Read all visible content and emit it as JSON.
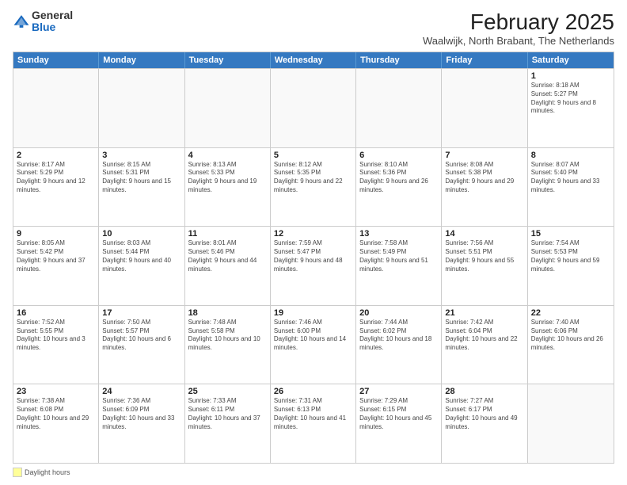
{
  "header": {
    "logo_general": "General",
    "logo_blue": "Blue",
    "month": "February 2025",
    "location": "Waalwijk, North Brabant, The Netherlands"
  },
  "days_of_week": [
    "Sunday",
    "Monday",
    "Tuesday",
    "Wednesday",
    "Thursday",
    "Friday",
    "Saturday"
  ],
  "weeks": [
    [
      {
        "day": "",
        "info": ""
      },
      {
        "day": "",
        "info": ""
      },
      {
        "day": "",
        "info": ""
      },
      {
        "day": "",
        "info": ""
      },
      {
        "day": "",
        "info": ""
      },
      {
        "day": "",
        "info": ""
      },
      {
        "day": "1",
        "info": "Sunrise: 8:18 AM\nSunset: 5:27 PM\nDaylight: 9 hours and 8 minutes."
      }
    ],
    [
      {
        "day": "2",
        "info": "Sunrise: 8:17 AM\nSunset: 5:29 PM\nDaylight: 9 hours and 12 minutes."
      },
      {
        "day": "3",
        "info": "Sunrise: 8:15 AM\nSunset: 5:31 PM\nDaylight: 9 hours and 15 minutes."
      },
      {
        "day": "4",
        "info": "Sunrise: 8:13 AM\nSunset: 5:33 PM\nDaylight: 9 hours and 19 minutes."
      },
      {
        "day": "5",
        "info": "Sunrise: 8:12 AM\nSunset: 5:35 PM\nDaylight: 9 hours and 22 minutes."
      },
      {
        "day": "6",
        "info": "Sunrise: 8:10 AM\nSunset: 5:36 PM\nDaylight: 9 hours and 26 minutes."
      },
      {
        "day": "7",
        "info": "Sunrise: 8:08 AM\nSunset: 5:38 PM\nDaylight: 9 hours and 29 minutes."
      },
      {
        "day": "8",
        "info": "Sunrise: 8:07 AM\nSunset: 5:40 PM\nDaylight: 9 hours and 33 minutes."
      }
    ],
    [
      {
        "day": "9",
        "info": "Sunrise: 8:05 AM\nSunset: 5:42 PM\nDaylight: 9 hours and 37 minutes."
      },
      {
        "day": "10",
        "info": "Sunrise: 8:03 AM\nSunset: 5:44 PM\nDaylight: 9 hours and 40 minutes."
      },
      {
        "day": "11",
        "info": "Sunrise: 8:01 AM\nSunset: 5:46 PM\nDaylight: 9 hours and 44 minutes."
      },
      {
        "day": "12",
        "info": "Sunrise: 7:59 AM\nSunset: 5:47 PM\nDaylight: 9 hours and 48 minutes."
      },
      {
        "day": "13",
        "info": "Sunrise: 7:58 AM\nSunset: 5:49 PM\nDaylight: 9 hours and 51 minutes."
      },
      {
        "day": "14",
        "info": "Sunrise: 7:56 AM\nSunset: 5:51 PM\nDaylight: 9 hours and 55 minutes."
      },
      {
        "day": "15",
        "info": "Sunrise: 7:54 AM\nSunset: 5:53 PM\nDaylight: 9 hours and 59 minutes."
      }
    ],
    [
      {
        "day": "16",
        "info": "Sunrise: 7:52 AM\nSunset: 5:55 PM\nDaylight: 10 hours and 3 minutes."
      },
      {
        "day": "17",
        "info": "Sunrise: 7:50 AM\nSunset: 5:57 PM\nDaylight: 10 hours and 6 minutes."
      },
      {
        "day": "18",
        "info": "Sunrise: 7:48 AM\nSunset: 5:58 PM\nDaylight: 10 hours and 10 minutes."
      },
      {
        "day": "19",
        "info": "Sunrise: 7:46 AM\nSunset: 6:00 PM\nDaylight: 10 hours and 14 minutes."
      },
      {
        "day": "20",
        "info": "Sunrise: 7:44 AM\nSunset: 6:02 PM\nDaylight: 10 hours and 18 minutes."
      },
      {
        "day": "21",
        "info": "Sunrise: 7:42 AM\nSunset: 6:04 PM\nDaylight: 10 hours and 22 minutes."
      },
      {
        "day": "22",
        "info": "Sunrise: 7:40 AM\nSunset: 6:06 PM\nDaylight: 10 hours and 26 minutes."
      }
    ],
    [
      {
        "day": "23",
        "info": "Sunrise: 7:38 AM\nSunset: 6:08 PM\nDaylight: 10 hours and 29 minutes."
      },
      {
        "day": "24",
        "info": "Sunrise: 7:36 AM\nSunset: 6:09 PM\nDaylight: 10 hours and 33 minutes."
      },
      {
        "day": "25",
        "info": "Sunrise: 7:33 AM\nSunset: 6:11 PM\nDaylight: 10 hours and 37 minutes."
      },
      {
        "day": "26",
        "info": "Sunrise: 7:31 AM\nSunset: 6:13 PM\nDaylight: 10 hours and 41 minutes."
      },
      {
        "day": "27",
        "info": "Sunrise: 7:29 AM\nSunset: 6:15 PM\nDaylight: 10 hours and 45 minutes."
      },
      {
        "day": "28",
        "info": "Sunrise: 7:27 AM\nSunset: 6:17 PM\nDaylight: 10 hours and 49 minutes."
      },
      {
        "day": "",
        "info": ""
      }
    ]
  ],
  "footer": {
    "legend_label": "Daylight hours"
  }
}
